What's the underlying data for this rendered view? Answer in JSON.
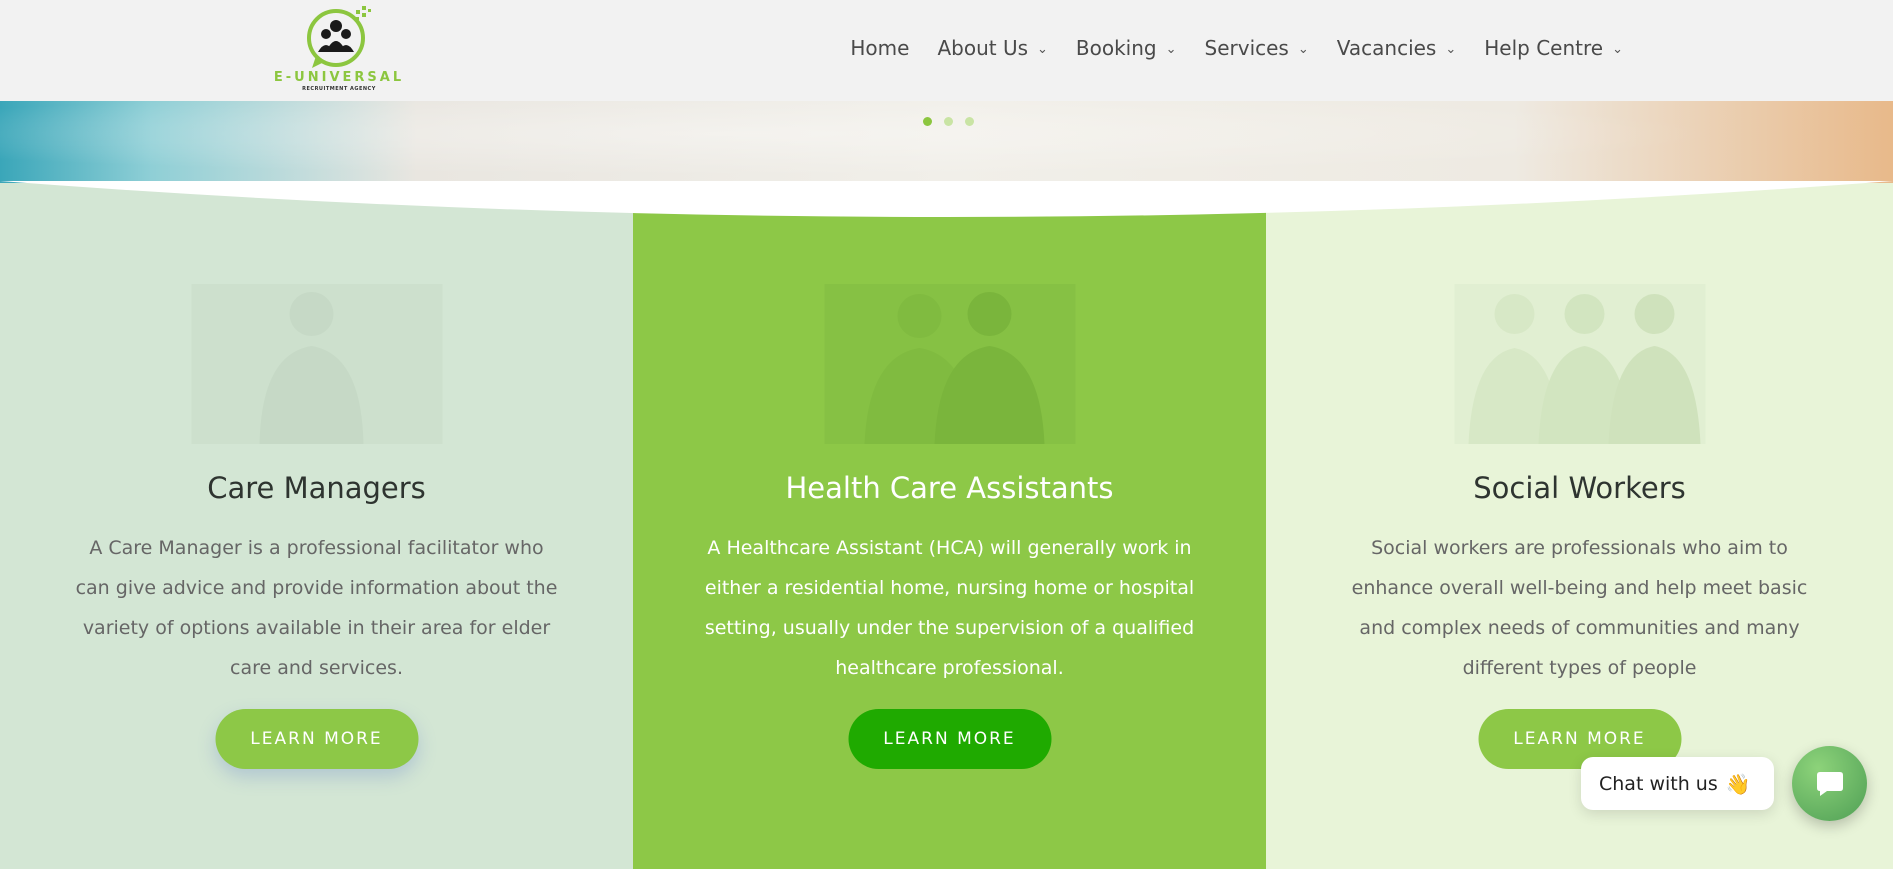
{
  "header": {
    "logo": {
      "brand": "E-UNIVERSAL",
      "tagline": "RECRUITMENT AGENCY"
    },
    "nav": [
      {
        "label": "Home",
        "has_dropdown": false
      },
      {
        "label": "About Us",
        "has_dropdown": true
      },
      {
        "label": "Booking",
        "has_dropdown": true
      },
      {
        "label": "Services",
        "has_dropdown": true
      },
      {
        "label": "Vacancies",
        "has_dropdown": true
      },
      {
        "label": "Help Centre",
        "has_dropdown": true
      }
    ]
  },
  "slider": {
    "dot_count": 3,
    "active_index": 0
  },
  "panels": [
    {
      "title": "Care Managers",
      "description": "A Care Manager is a professional facilitator who can give advice and provide information about the variety of options available in their area for elder care and services.",
      "button": "LEARN MORE",
      "background": "#d3e6d4"
    },
    {
      "title": "Health Care Assistants",
      "description": "A Healthcare Assistant (HCA) will generally work in either a residential home, nursing home or hospital setting, usually under the supervision of a qualified healthcare professional.",
      "button": "LEARN MORE",
      "background": "#8dc847"
    },
    {
      "title": "Social Workers",
      "description": "Social workers are professionals who aim to enhance overall well-being and help meet basic and complex needs of communities and many different types of people",
      "button": "LEARN MORE",
      "background": "#e8f4d8"
    }
  ],
  "chat": {
    "label": "Chat with us",
    "emoji": "👋"
  },
  "colors": {
    "accent": "#8dc847",
    "button_dark": "#1faa00",
    "header_bg": "#f2f2f2"
  }
}
